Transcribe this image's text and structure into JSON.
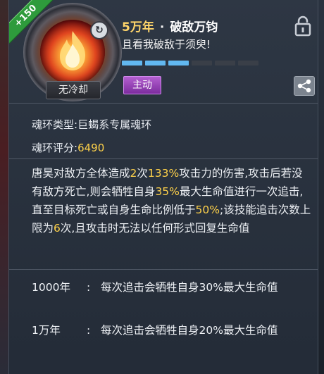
{
  "badge": "+150",
  "skill": {
    "level_label": "5万年",
    "separator": "·",
    "name": "破敌万钧",
    "subtitle": "且看我破敌于须臾!",
    "cooldown_label": "无冷却",
    "type_tag": "主动",
    "progress": {
      "filled": 3,
      "total": 6
    }
  },
  "info": {
    "ring_type_label": "魂环类型:",
    "ring_type_value": "巨蝎系专属魂环",
    "score_label": "魂环评分:",
    "score_value": "6490"
  },
  "description": [
    {
      "t": "唐昊对敌方全体造成"
    },
    {
      "t": "2",
      "hl": true
    },
    {
      "t": "次"
    },
    {
      "t": "133%",
      "hl": true
    },
    {
      "t": "攻击力的伤害,"
    },
    {
      "t": "攻击后若没有敌方死亡,则会牺牲自身"
    },
    {
      "t": "35%",
      "hl": true
    },
    {
      "t": "最大生命值进行一次追击,直至目标死亡或自身生命比例低于"
    },
    {
      "t": "50%",
      "hl": true
    },
    {
      "t": ";该技能追击次数上限为"
    },
    {
      "t": "6",
      "hl": true
    },
    {
      "t": "次,且攻击时无法以任何形式回复生命值"
    }
  ],
  "levels": [
    {
      "key": "1000年",
      "colon": ":",
      "value": "每次追击会牺牲自身30%最大生命值"
    },
    {
      "key": "1万年",
      "colon": ":",
      "value": "每次追击会牺牲自身20%最大生命值"
    }
  ],
  "colors": {
    "gold": "#ffd24a",
    "progress_on": "#62b8f0",
    "tag_purple": "#9b46be",
    "badge_green": "#2e9b3c"
  }
}
